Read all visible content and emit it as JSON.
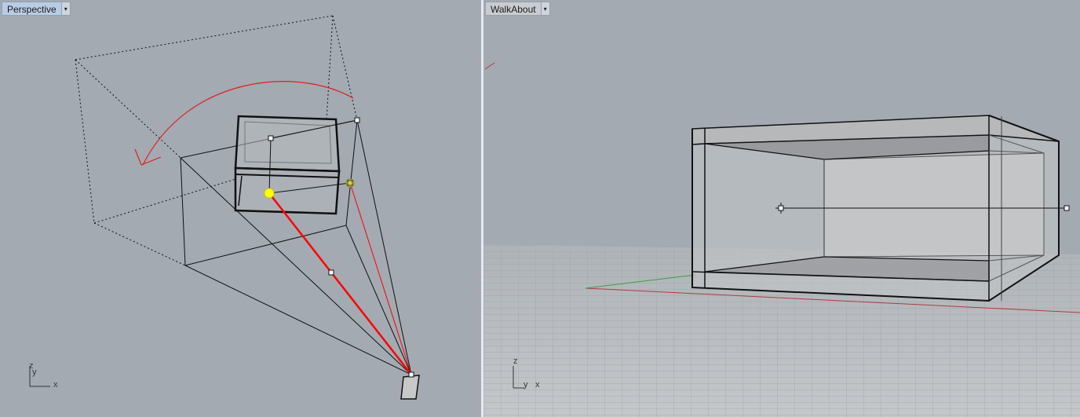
{
  "viewports": {
    "left": {
      "title": "Perspective",
      "menu_glyph": "▾"
    },
    "right": {
      "title": "WalkAbout",
      "menu_glyph": "▾"
    }
  },
  "axis_labels": {
    "left": {
      "z": "z",
      "y": "y",
      "x": "x"
    },
    "right": {
      "z": "z",
      "y": "y",
      "x": "x"
    }
  },
  "colors": {
    "viewport_bg": "#a3aab2",
    "camera_line": "#ff0000",
    "target_point": "#ffff00",
    "rotation_arc": "#e0201e",
    "grid_x_axis": "#b03a3a",
    "grid_y_axis": "#3aa03a"
  },
  "icons": {
    "camera": "camera-icon",
    "target": "target-point-icon",
    "rotation": "rotate-arrow-icon"
  }
}
